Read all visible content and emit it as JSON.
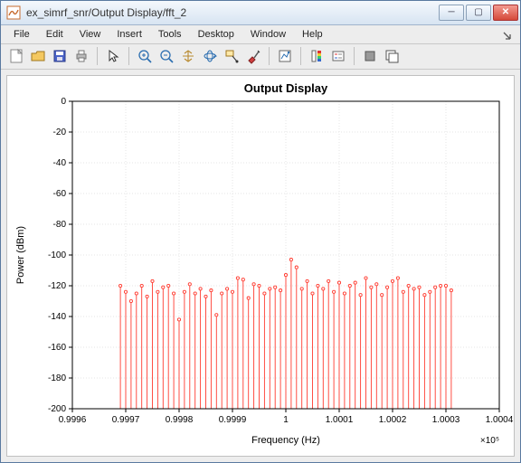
{
  "window": {
    "title": "ex_simrf_snr/Output Display/fft_2"
  },
  "menu": {
    "items": [
      "File",
      "Edit",
      "View",
      "Insert",
      "Tools",
      "Desktop",
      "Window",
      "Help"
    ]
  },
  "toolbar": {
    "icons": [
      "new-figure-icon",
      "open-icon",
      "save-icon",
      "print-icon",
      "SEP",
      "pointer-icon",
      "SEP",
      "zoom-in-icon",
      "zoom-out-icon",
      "pan-icon",
      "rotate3d-icon",
      "datacursor-icon",
      "brush-icon",
      "SEP",
      "link-plot-icon",
      "SEP",
      "colorbar-icon",
      "legend-icon",
      "SEP",
      "hide-tools-icon",
      "show-tools-icon"
    ]
  },
  "chart_data": {
    "type": "bar",
    "title": "Output Display",
    "xlabel": "Frequency (Hz)",
    "ylabel": "Power (dBm)",
    "x_exponent_label": "×10⁵",
    "xlim": [
      0.9996,
      1.0004
    ],
    "ylim": [
      -200,
      0
    ],
    "xticks": [
      0.9996,
      0.9997,
      0.9998,
      0.9999,
      1,
      1.0001,
      1.0002,
      1.0003,
      1.0004
    ],
    "yticks": [
      0,
      -20,
      -40,
      -60,
      -80,
      -100,
      -120,
      -140,
      -160,
      -180,
      -200
    ],
    "x": [
      0.99969,
      0.9997,
      0.99971,
      0.99972,
      0.99973,
      0.99974,
      0.99975,
      0.99976,
      0.99977,
      0.99978,
      0.99979,
      0.9998,
      0.99981,
      0.99982,
      0.99983,
      0.99984,
      0.99985,
      0.99986,
      0.99987,
      0.99988,
      0.99989,
      0.9999,
      0.99991,
      0.99992,
      0.99993,
      0.99994,
      0.99995,
      0.99996,
      0.99997,
      0.99998,
      0.99999,
      1.0,
      1.00001,
      1.00002,
      1.00003,
      1.00004,
      1.00005,
      1.00006,
      1.00007,
      1.00008,
      1.00009,
      1.0001,
      1.00011,
      1.00012,
      1.00013,
      1.00014,
      1.00015,
      1.00016,
      1.00017,
      1.00018,
      1.00019,
      1.0002,
      1.00021,
      1.00022,
      1.00023,
      1.00024,
      1.00025,
      1.00026,
      1.00027,
      1.00028,
      1.00029,
      1.0003,
      1.00031
    ],
    "values": [
      -120,
      -124,
      -130,
      -125,
      -120,
      -127,
      -117,
      -124,
      -121,
      -120,
      -125,
      -142,
      -124,
      -119,
      -125,
      -122,
      -127,
      -123,
      -139,
      -125,
      -122,
      -124,
      -115,
      -116,
      -128,
      -119,
      -120,
      -125,
      -122,
      -121,
      -123,
      -113,
      -103,
      -108,
      -122,
      -117,
      -125,
      -120,
      -122,
      -117,
      -124,
      -118,
      -125,
      -120,
      -118,
      -126,
      -115,
      -121,
      -119,
      -126,
      -121,
      -117,
      -115,
      -124,
      -120,
      -122,
      -121,
      -126,
      -124,
      -121,
      -120,
      -120,
      -123
    ],
    "color": "#ff3b30"
  }
}
